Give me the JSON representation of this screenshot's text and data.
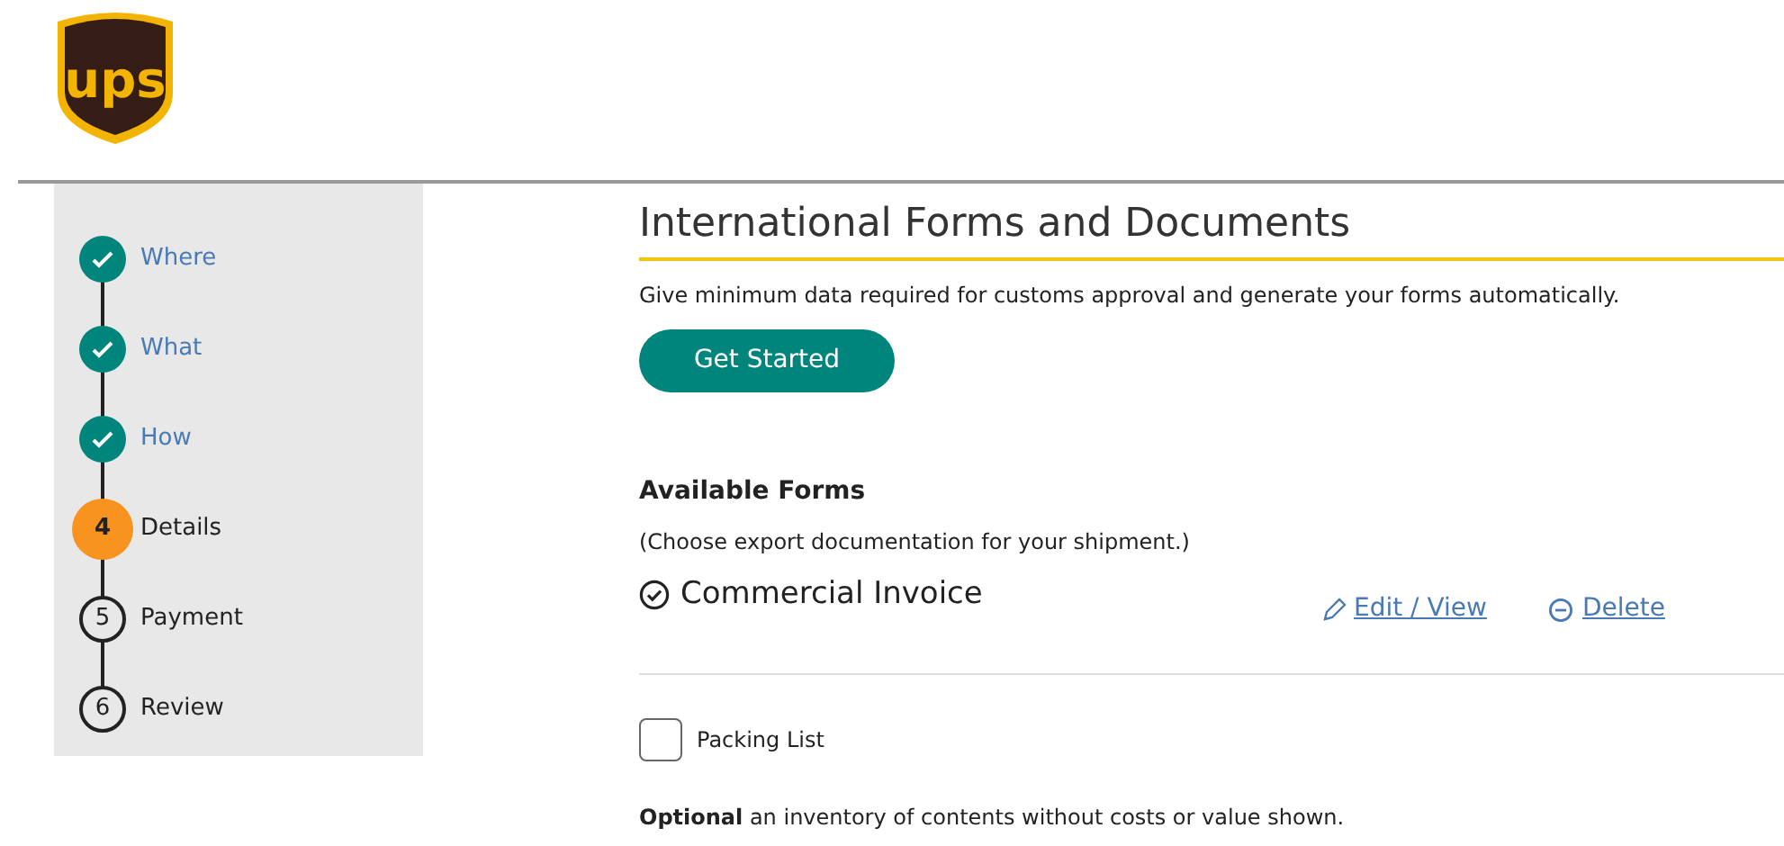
{
  "logo": {
    "text": "ups"
  },
  "steps": [
    {
      "label": "Where",
      "kind": "done"
    },
    {
      "label": "What",
      "kind": "done"
    },
    {
      "label": "How",
      "kind": "done"
    },
    {
      "label": "Details",
      "number": "4",
      "kind": "current"
    },
    {
      "label": "Payment",
      "number": "5",
      "kind": "pending"
    },
    {
      "label": "Review",
      "number": "6",
      "kind": "pending"
    }
  ],
  "title": "International Forms and Documents",
  "description": "Give minimum data required for customs approval and generate your forms automatically.",
  "get_started_button": "Get Started",
  "available_forms": {
    "heading": "Available Forms",
    "subtext": "(Choose export documentation for your shipment.)",
    "selected_form": {
      "label": "Commercial Invoice",
      "edit_link": "Edit / View",
      "delete_link": "Delete"
    },
    "options": [
      {
        "label": "Packing List",
        "checked": false,
        "note": "**Optional** an inventory of contents without costs or value shown."
      }
    ]
  }
}
